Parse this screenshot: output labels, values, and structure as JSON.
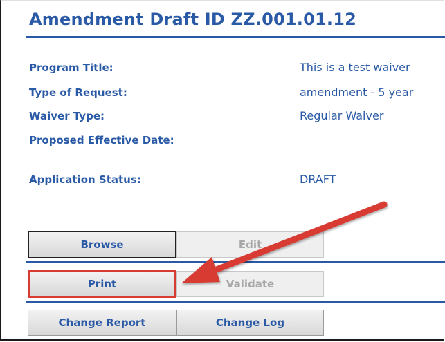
{
  "header": {
    "title": "Amendment Draft ID ZZ.001.01.12"
  },
  "fields": [
    {
      "label": "Program Title:",
      "value": "This is a test waiver"
    },
    {
      "label": "Type of Request:",
      "value": "amendment - 5 year"
    },
    {
      "label": "Waiver Type:",
      "value": "Regular Waiver"
    },
    {
      "label": "Proposed Effective Date:",
      "value": ""
    },
    {
      "label": "Application Status:",
      "value": "DRAFT"
    }
  ],
  "buttons": {
    "browse": "Browse",
    "edit": "Edit",
    "print": "Print",
    "validate": "Validate",
    "change_report": "Change Report",
    "change_log": "Change Log"
  },
  "colors": {
    "accent": "#2a5aa6",
    "annotation": "#d73b32"
  }
}
